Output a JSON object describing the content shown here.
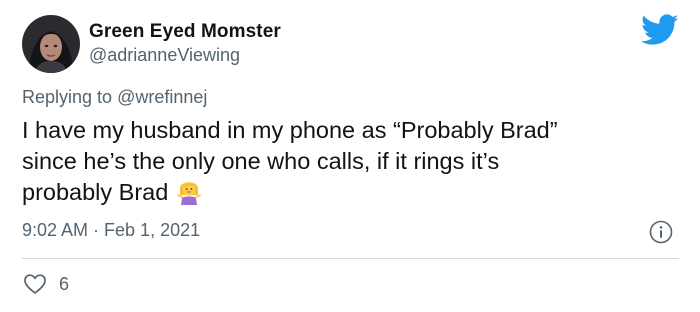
{
  "author": {
    "display_name": "Green Eyed Momster",
    "handle": "@adrianneViewing"
  },
  "reply": {
    "prefix": "Replying to",
    "mention": "@wrefinnej"
  },
  "tweet": {
    "lines": [
      "I have my husband in my phone as “Probably Brad”",
      "since he’s the only one who calls, if it rings it’s",
      "probably Brad"
    ],
    "emoji": "woman-shrugging-emoji",
    "timestamp": "9:02 AM · Feb 1, 2021"
  },
  "actions": {
    "like_count": "6"
  },
  "icons": {
    "brand": "twitter-bird-icon",
    "info": "info-icon",
    "like": "heart-icon"
  },
  "colors": {
    "brand_blue": "#1d9bf0",
    "text": "#0f1419",
    "secondary": "#536471",
    "divider": "#cfd9de"
  }
}
